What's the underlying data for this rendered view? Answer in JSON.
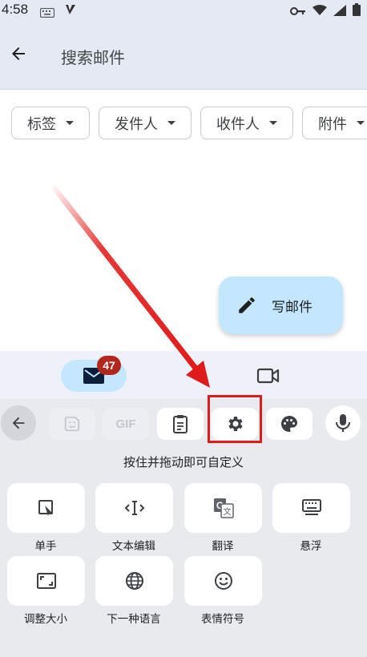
{
  "status_bar": {
    "time": "4:58"
  },
  "header": {
    "title": "搜索邮件"
  },
  "filters": [
    {
      "label": "标签"
    },
    {
      "label": "发件人"
    },
    {
      "label": "收件人"
    },
    {
      "label": "附件"
    }
  ],
  "compose": {
    "label": "写邮件"
  },
  "bottom_nav": {
    "mail_badge": "47"
  },
  "keyboard": {
    "hint": "按住并拖动即可自定义",
    "tiles": [
      {
        "label": "单手",
        "icon": "one-handed-icon"
      },
      {
        "label": "文本编辑",
        "icon": "text-edit-icon"
      },
      {
        "label": "翻译",
        "icon": "translate-icon"
      },
      {
        "label": "悬浮",
        "icon": "floating-keyboard-icon"
      },
      {
        "label": "调整大小",
        "icon": "resize-icon"
      },
      {
        "label": "下一种语言",
        "icon": "globe-icon"
      },
      {
        "label": "表情符号",
        "icon": "emoji-icon"
      }
    ],
    "toolbar": {
      "gif_label": "GIF"
    }
  },
  "colors": {
    "accent": "#c2e7ff",
    "badge": "#b3261e",
    "annotation": "#e01b1b"
  }
}
